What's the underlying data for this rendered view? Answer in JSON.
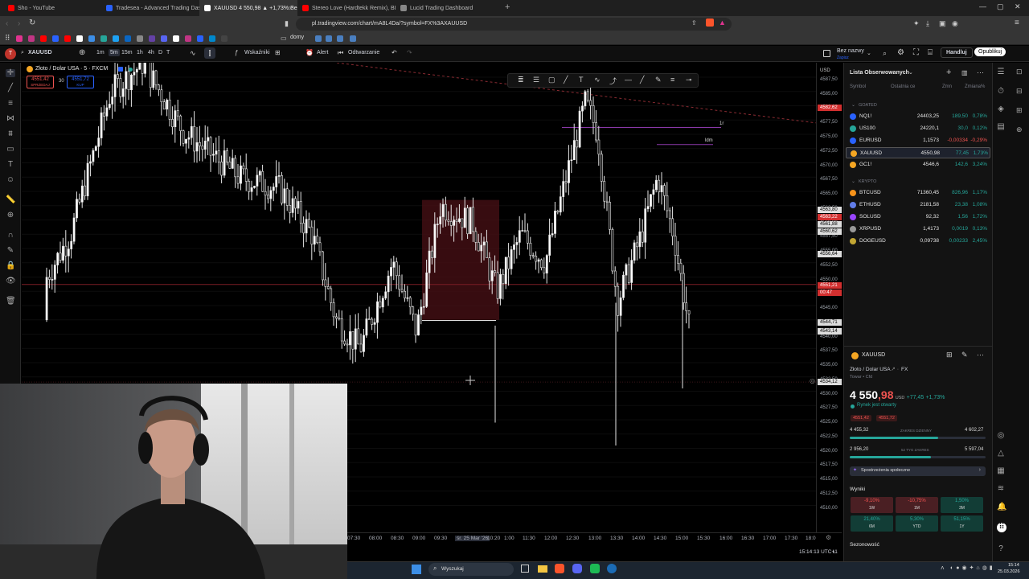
{
  "browser": {
    "tabs": [
      {
        "label": "Sho - YouTube",
        "color": "#ff0000",
        "active": false
      },
      {
        "label": "Tradesea - Advanced Trading Dashb",
        "color": "#2962ff",
        "active": false
      },
      {
        "label": "XAUUSD 4 550,98 ▲ +1,73% Bez",
        "color": "#ffffff",
        "active": true
      },
      {
        "label": "Stereo Love (Hardtekk Remix), BLESS",
        "color": "#ff0000",
        "active": false
      },
      {
        "label": "Lucid Trading Dashboard",
        "color": "#888888",
        "active": false
      }
    ],
    "new_tab": "+",
    "url": "pl.tradingview.com/chart/mA8L4Da/?symbol=FX%3AXAUUSD",
    "bookmark_folder": "domy"
  },
  "toolbar": {
    "symbol": "XAUUSD",
    "intervals": [
      "1m",
      "5m",
      "15m",
      "1h",
      "4h",
      "D",
      "T"
    ],
    "active_interval": "5m",
    "indicators": "Wskaźniki",
    "alert": "Alert",
    "replay": "Odtwarzanie",
    "layout_name": "Bez nazwy",
    "layout_sub": "Zapisz",
    "trade": "Handluj",
    "publish": "Opublikuj"
  },
  "legend": {
    "title": "Złoto / Dolar USA · 5 · FXCM",
    "sell_price": "4551,42",
    "sell_label": "SPRZEDAJ",
    "spread": "30",
    "buy_price": "4551,72",
    "buy_label": "KUP"
  },
  "chart_data": {
    "type": "candlestick",
    "price_axis": [
      "4587,50",
      "4585,00",
      "4580,00",
      "4577,50",
      "4575,00",
      "4572,50",
      "4570,00",
      "4567,50",
      "4565,00",
      "4562,50",
      "4560,00",
      "4557,50",
      "4555,00",
      "4552,50",
      "4550,00",
      "4547,50",
      "4545,00",
      "4542,50",
      "4540,00",
      "4537,50",
      "4535,00",
      "4532,50",
      "4530,00",
      "4527,50",
      "4525,00",
      "4522,50",
      "4520,00",
      "4517,50",
      "4515,00",
      "4512,50",
      "4510,00"
    ],
    "time_axis": [
      "07:30",
      "08:00",
      "08:30",
      "09:00",
      "09:30",
      "śr. 25 Mar '26",
      "10:20",
      "1:00",
      "11:30",
      "12:00",
      "12:30",
      "13:00",
      "13:30",
      "14:00",
      "14:30",
      "15:00",
      "15:30",
      "16:00",
      "16:30",
      "17:00",
      "17:30",
      "18:0"
    ],
    "price_tags": [
      {
        "label": "USD",
        "type": "unit"
      },
      {
        "label": "4582,62",
        "type": "red"
      },
      {
        "label": "4563,80",
        "type": "plain"
      },
      {
        "label": "4563,22",
        "type": "red"
      },
      {
        "label": "4561,88",
        "type": "plain"
      },
      {
        "label": "4560,62",
        "type": "plain"
      },
      {
        "label": "4556,64",
        "type": "plain"
      },
      {
        "label": "4551,21",
        "type": "red"
      },
      {
        "label": "00:47",
        "type": "red"
      },
      {
        "label": "4544,71",
        "type": "plain"
      },
      {
        "label": "4543,14",
        "type": "plain"
      },
      {
        "label": "4534,12",
        "type": "plain"
      }
    ],
    "annotations": [
      "1r",
      "ldm"
    ],
    "clock": "15:14:13 UTC+1",
    "scale_mode": "L"
  },
  "watchlist": {
    "title": "Lista Obserwowanych",
    "columns": [
      "Symbol",
      "Ostatnia ce",
      "Zmn",
      "Zmiana%"
    ],
    "sections": [
      {
        "name": "GOATED",
        "rows": [
          {
            "symbol": "NQ1!",
            "last": "24403,25",
            "chg": "189,50",
            "pct": "0,78%",
            "dir": "pos",
            "color": "#2962ff"
          },
          {
            "symbol": "US100",
            "last": "24220,1",
            "chg": "30,0",
            "pct": "0,12%",
            "dir": "pos",
            "color": "#26a69a"
          },
          {
            "symbol": "EURUSD",
            "last": "1,1573",
            "chg": "-0,00334",
            "pct": "-0,29%",
            "dir": "neg",
            "color": "#2962ff"
          },
          {
            "symbol": "XAUUSD",
            "last": "4550,98",
            "chg": "77,45",
            "pct": "1,73%",
            "dir": "pos",
            "color": "#f5a623"
          },
          {
            "symbol": "GC1!",
            "last": "4546,6",
            "chg": "142,6",
            "pct": "3,24%",
            "dir": "pos",
            "color": "#f5a623"
          }
        ]
      },
      {
        "name": "KRYPTO",
        "rows": [
          {
            "symbol": "BTCUSD",
            "last": "71360,45",
            "chg": "826,96",
            "pct": "1,17%",
            "dir": "pos",
            "color": "#f7931a"
          },
          {
            "symbol": "ETHUSD",
            "last": "2181,58",
            "chg": "23,38",
            "pct": "1,08%",
            "dir": "pos",
            "color": "#627eea"
          },
          {
            "symbol": "SOLUSD",
            "last": "92,32",
            "chg": "1,56",
            "pct": "1,72%",
            "dir": "pos",
            "color": "#9945ff"
          },
          {
            "symbol": "XRPUSD",
            "last": "1,4173",
            "chg": "0,0019",
            "pct": "0,13%",
            "dir": "pos",
            "color": "#999999"
          },
          {
            "symbol": "DOGEUSD",
            "last": "0,09738",
            "chg": "0,00233",
            "pct": "2,45%",
            "dir": "pos",
            "color": "#c2a633"
          }
        ]
      }
    ]
  },
  "details": {
    "symbol": "XAUUSD",
    "name": "Złoto / Dolar USA",
    "exchange": "FX",
    "category": "Towar • Cfd",
    "price_main": "4 550",
    "price_dec": ",98",
    "currency": "USD",
    "change": "+77,45",
    "change_pct": "+1,73%",
    "market_status": "Rynek jest otwarty",
    "bid": "4551,42",
    "ask": "4551,72",
    "day_low": "4 455,32",
    "day_range_label": "ZAKRES DZIENNY",
    "day_high": "4 602,27",
    "day_fraction": 0.65,
    "year_low": "2 956,20",
    "year_range_label": "52 TYG ZAKRES",
    "year_high": "5 597,04",
    "year_fraction": 0.6,
    "community_label": "Spostrzeżenia społeczne",
    "results_title": "Wyniki",
    "performance": [
      {
        "value": "-9,10%",
        "period": "1W",
        "dir": "neg"
      },
      {
        "value": "-10,75%",
        "period": "1M",
        "dir": "neg"
      },
      {
        "value": "1,50%",
        "period": "3M",
        "dir": "pos"
      },
      {
        "value": "21,40%",
        "period": "6M",
        "dir": "pos"
      },
      {
        "value": "5,30%",
        "period": "YTD",
        "dir": "pos"
      },
      {
        "value": "51,15%",
        "period": "1Y",
        "dir": "pos"
      }
    ],
    "seasonality": "Sezonowość"
  },
  "taskbar": {
    "search": "Wyszukaj",
    "time": "15:14",
    "date": "25.03.2026"
  },
  "colors": {
    "bg": "#000000",
    "panel": "#131313",
    "up": "#26a69a",
    "down": "#ef5350",
    "accent": "#2962ff"
  }
}
